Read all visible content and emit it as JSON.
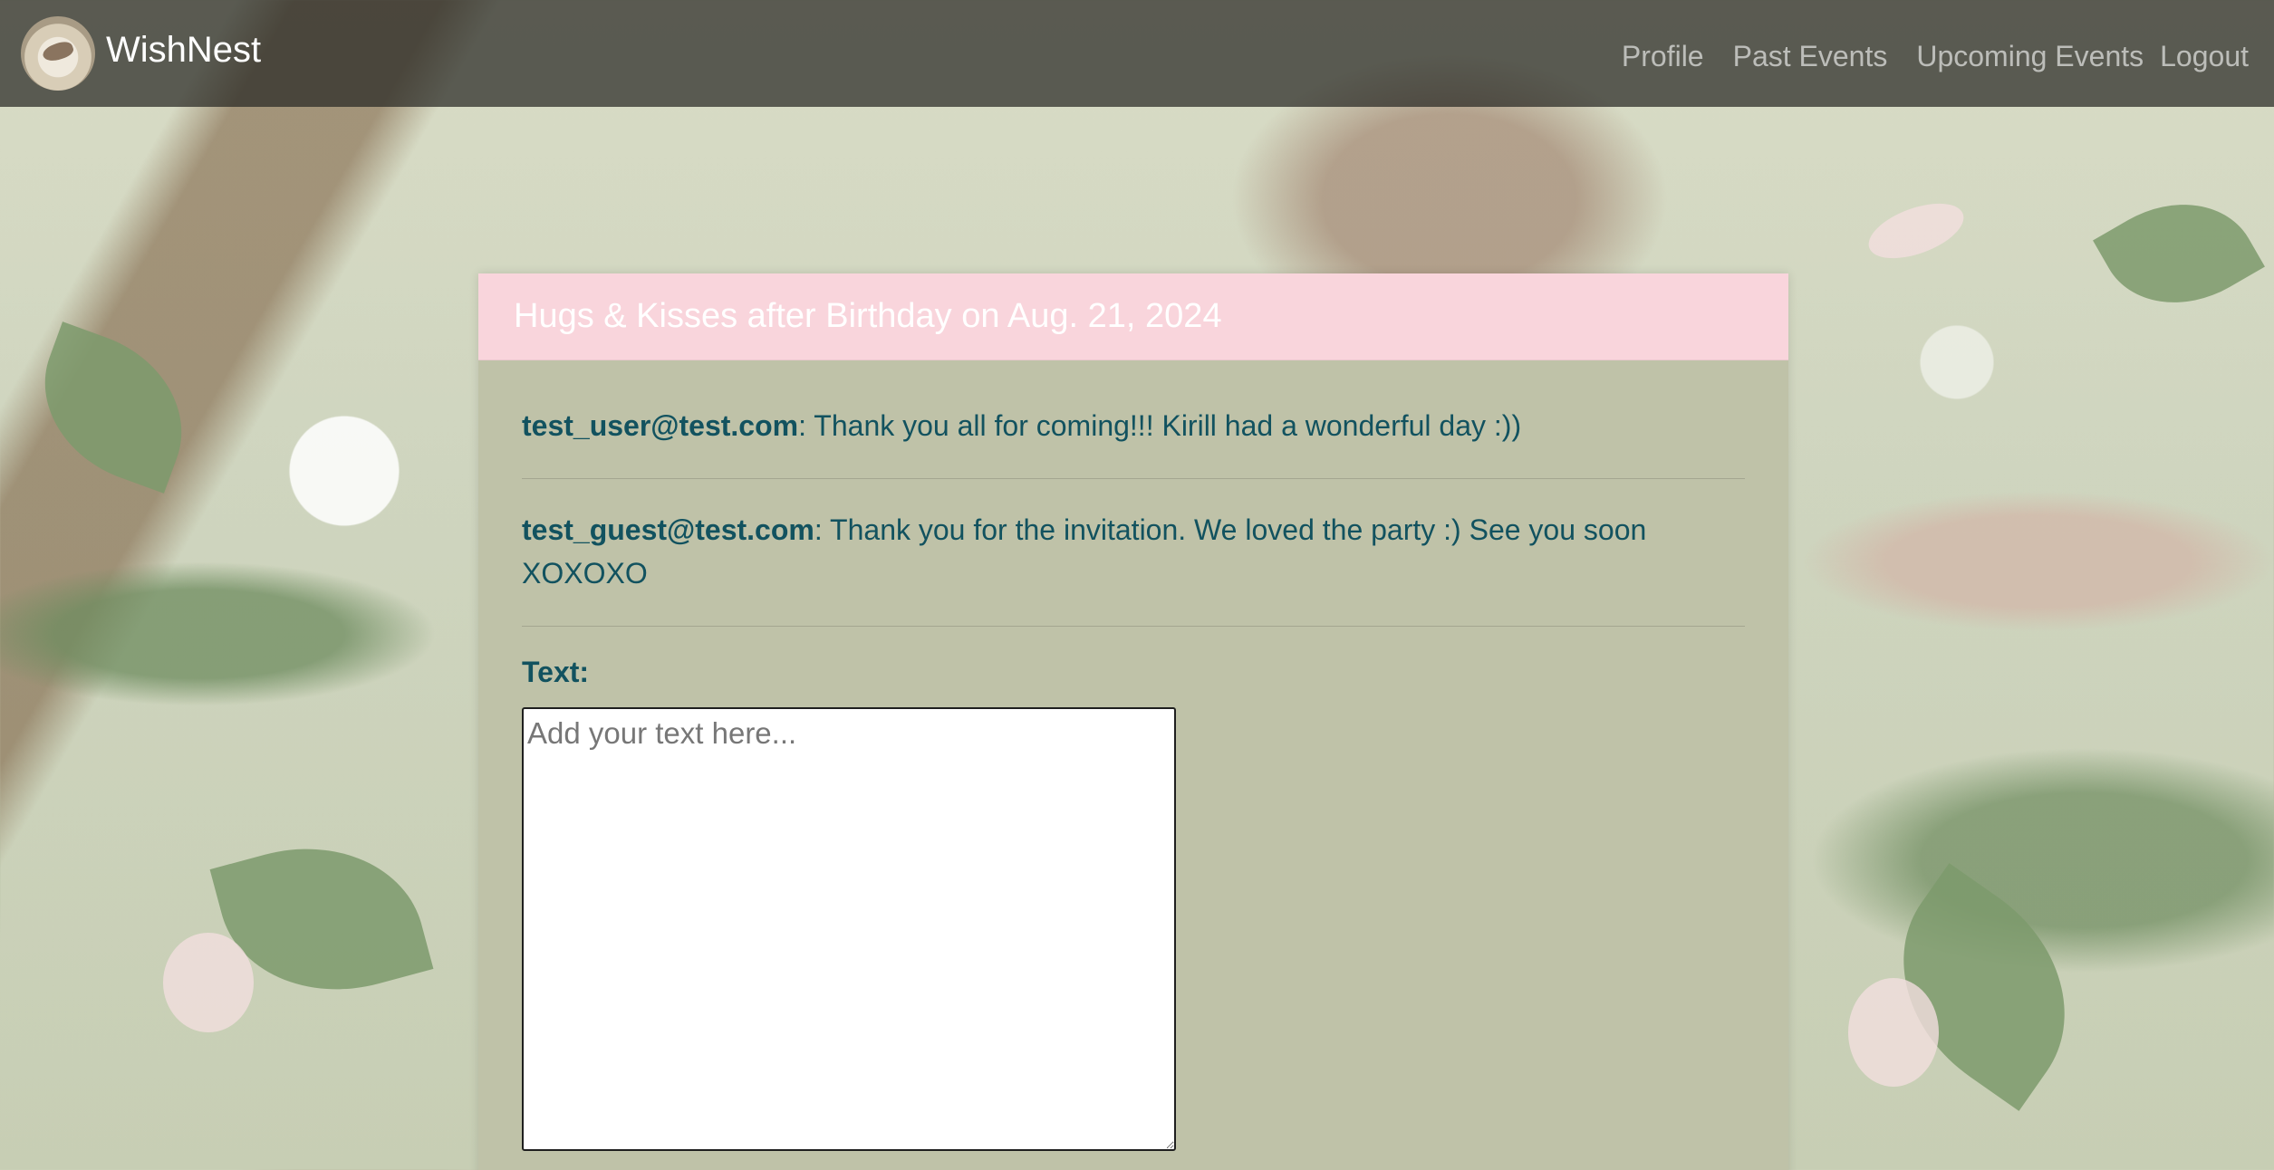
{
  "app": {
    "brand_name": "WishNest",
    "logo_icon": "bird-nest-logo-icon"
  },
  "nav": {
    "items": [
      {
        "label": "Profile"
      },
      {
        "label": "Past Events"
      },
      {
        "label": "Upcoming Events"
      },
      {
        "label": "Logout"
      }
    ]
  },
  "card": {
    "title": "Hugs & Kisses after Birthday on Aug. 21, 2024",
    "messages": [
      {
        "author": "test_user@test.com",
        "text": ": Thank you all for coming!!! Kirill had a wonderful day :))"
      },
      {
        "author": "test_guest@test.com",
        "text": ": Thank you for the invitation. We loved the party :) See you soon XOXOXO"
      }
    ],
    "form": {
      "text_label": "Text:",
      "text_value": "",
      "text_placeholder": "Add your text here..."
    }
  },
  "colors": {
    "header_pink": "#f9d5dc",
    "card_bg": "#bfc2a8",
    "text_teal": "#12525f",
    "navbar_bg": "#28282499"
  }
}
